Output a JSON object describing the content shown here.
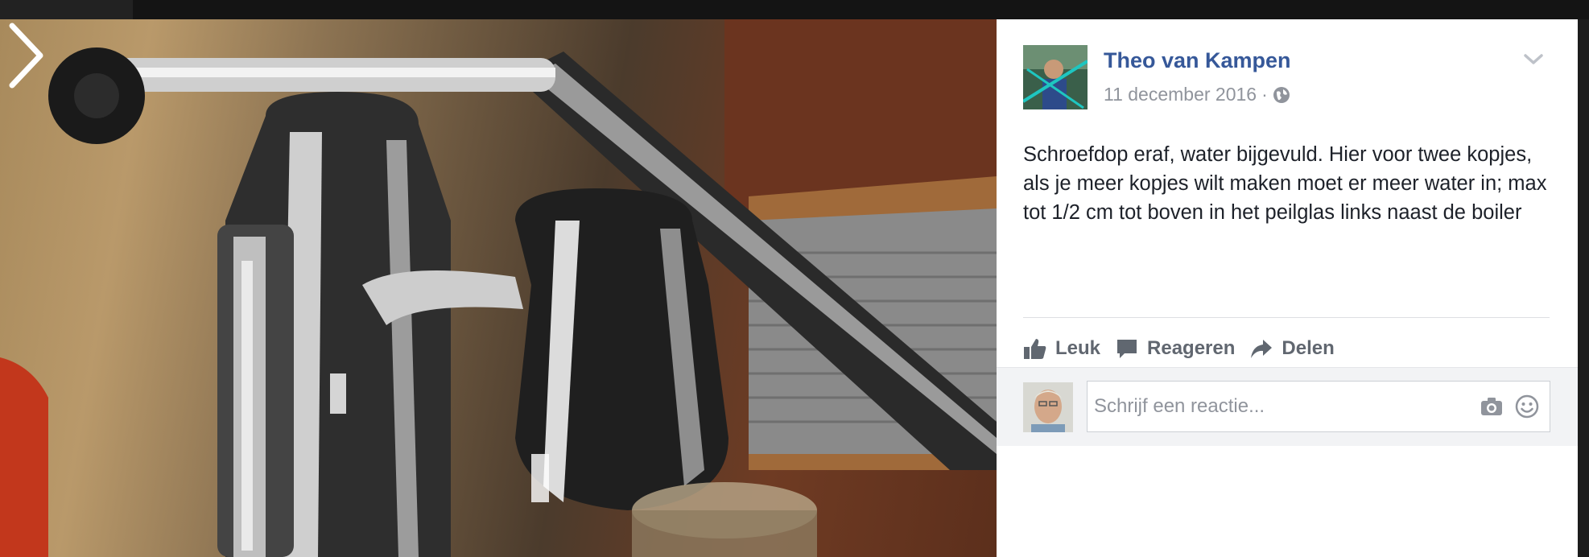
{
  "post": {
    "author": "Theo van Kampen",
    "date": "11 december 2016",
    "separator": "·",
    "privacy_icon": "globe-icon",
    "text": "Schroefdop eraf, water bijgevuld. Hier voor twee kopjes, als je meer kopjes wilt maken moet er meer water in; max tot 1/2 cm tot boven in het peilglas links naast de boiler"
  },
  "actions": {
    "like": "Leuk",
    "comment": "Reageren",
    "share": "Delen"
  },
  "comment": {
    "placeholder": "Schrijf een reactie...",
    "camera_icon": "camera-icon",
    "emoji_icon": "smiley-icon"
  },
  "colors": {
    "author_link": "#365899",
    "meta_text": "#90949c",
    "action_text": "#616770"
  }
}
